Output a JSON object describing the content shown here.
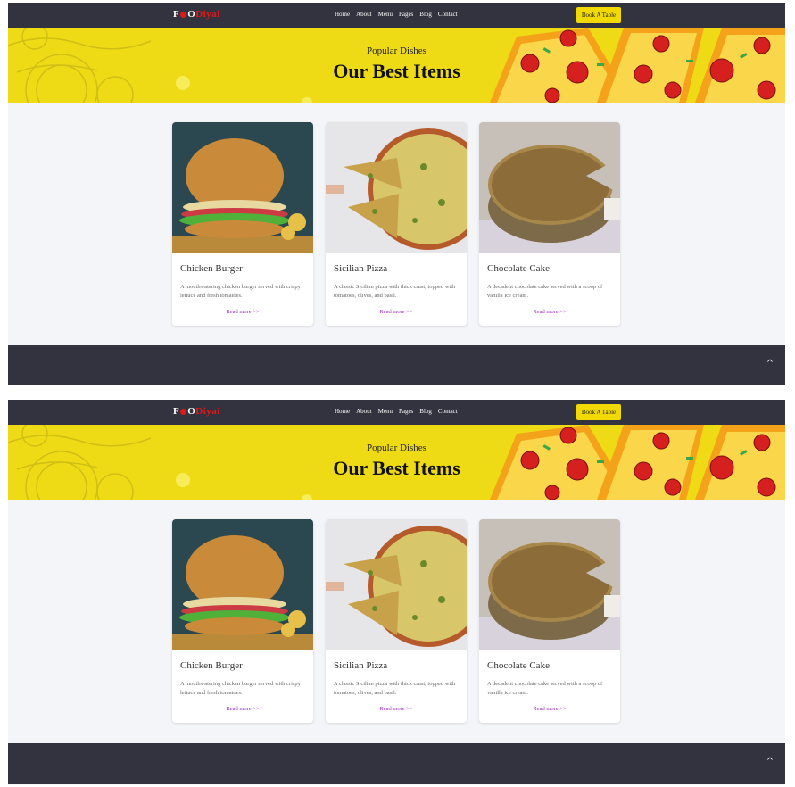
{
  "logo": {
    "part1": "F",
    "part2": "O",
    "part3": "Diyai"
  },
  "nav": {
    "items": [
      "Home",
      "About",
      "Menu",
      "Pages",
      "Blog",
      "Contact"
    ],
    "book_label": "Book A Table"
  },
  "hero": {
    "subtitle": "Popular Dishes",
    "title": "Our Best Items"
  },
  "cards": [
    {
      "title": "Chicken Burger",
      "desc": "A mouthwatering chicken burger served with crispy lettuce and fresh tomatoes.",
      "link": "Read more >>"
    },
    {
      "title": "Sicilian Pizza",
      "desc": "A classic Sicilian pizza with thick crust, topped with tomatoes, olives, and basil.",
      "link": "Read more >>"
    },
    {
      "title": "Chocolate Cake",
      "desc": "A decadent chocolate cake served with a scoop of vanilla ice cream.",
      "link": "Read more >>"
    }
  ],
  "footer": {
    "up_icon": "^"
  },
  "colors": {
    "nav_bg": "#33333f",
    "accent_yellow": "#f2d900",
    "hero_bg": "#eedb16",
    "link_purple": "#9b2ac2",
    "logo_red": "#e01818"
  }
}
